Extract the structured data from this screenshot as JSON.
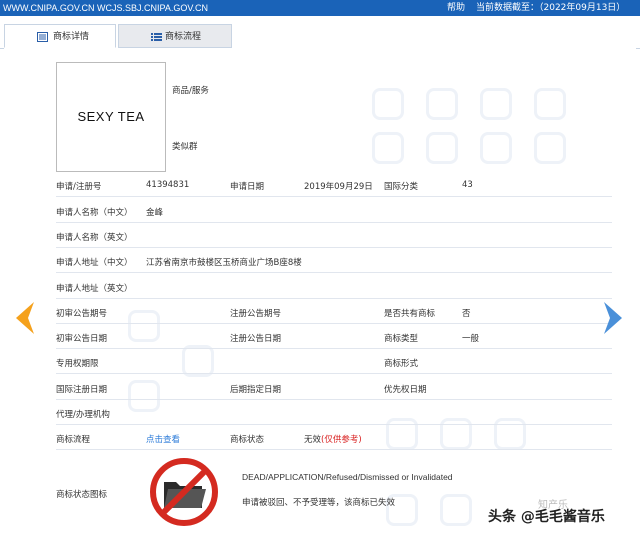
{
  "topbar": {
    "site": "WWW.CNIPA.GOV.CN WCJS.SBJ.CNIPA.GOV.CN",
    "help": "帮助",
    "date": "当前数据截至：（2022年09月13日）"
  },
  "tabs": [
    {
      "label": "商标详情",
      "icon": "list-icon"
    },
    {
      "label": "商标流程",
      "icon": "list-icon"
    }
  ],
  "logo_text": "SEXY TEA",
  "fields": {
    "goods_label": "商品/服务",
    "similar_label": "类似群",
    "reg_no_label": "申请/注册号",
    "reg_no": "41394831",
    "apply_date_label": "申请日期",
    "apply_date": "2019年09月29日",
    "intl_class_label": "国际分类",
    "intl_class": "43",
    "applicant_cn_label": "申请人名称（中文）",
    "applicant_cn": "金峰",
    "applicant_en_label": "申请人名称（英文）",
    "address_cn_label": "申请人地址（中文）",
    "address_cn": "江苏省南京市鼓楼区玉桥商业广场B座8楼",
    "address_en_label": "申请人地址（英文）",
    "prelim_no_label": "初审公告期号",
    "reg_pub_no_label": "注册公告期号",
    "shared_label": "是否共有商标",
    "shared": "否",
    "prelim_date_label": "初审公告日期",
    "reg_pub_date_label": "注册公告日期",
    "mark_type_label": "商标类型",
    "mark_type": "一般",
    "exclusive_label": "专用权期限",
    "mark_form_label": "商标形式",
    "intl_reg_date_label": "国际注册日期",
    "later_date_label": "后期指定日期",
    "priority_date_label": "优先权日期",
    "agent_label": "代理/办理机构",
    "flow_label": "商标流程",
    "flow_link": "点击查看",
    "status_label": "商标状态",
    "status": "无效",
    "status_note": "(仅供参考)",
    "status_icon_label": "商标状态图标",
    "status_en": "DEAD/APPLICATION/Refused/Dismissed or Invalidated",
    "status_cn": "申请被驳回、不予受理等，该商标已失效"
  },
  "watermark": {
    "wechat": "知产乐",
    "toutiao": "头条 @毛毛酱音乐"
  },
  "colors": {
    "topbar": "#1a63b8",
    "arrow_left": "#f5a11c",
    "arrow_right": "#4a90d9",
    "link": "#2a7ad8",
    "invalid": "#d81e1e"
  }
}
